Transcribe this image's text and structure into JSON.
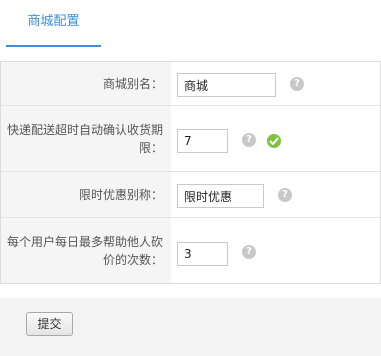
{
  "tabs": [
    {
      "label": "商城配置",
      "active": true
    }
  ],
  "form": {
    "fields": [
      {
        "label_lines": [
          "商城别名："
        ],
        "value": "商城",
        "help_icon": "question-circle-icon"
      },
      {
        "label_lines": [
          "快递配送超时自动确认收货期",
          "限："
        ],
        "value": "7",
        "help_icon": "question-circle-icon",
        "valid_icon": "check-circle-icon"
      },
      {
        "label_lines": [
          "限时优惠别称："
        ],
        "value": "限时优惠",
        "help_icon": "question-circle-icon"
      },
      {
        "label_lines": [
          "每个用户每日最多帮助他人砍",
          "价的次数："
        ],
        "value": "3",
        "help_icon": "question-circle-icon"
      }
    ]
  },
  "footer": {
    "submit_label": "提交"
  },
  "colors": {
    "accent": "#3b8fdc",
    "label_bg": "#f5f5f5",
    "valid_green": "#7dc242",
    "help_gray": "#c8c8c8"
  }
}
